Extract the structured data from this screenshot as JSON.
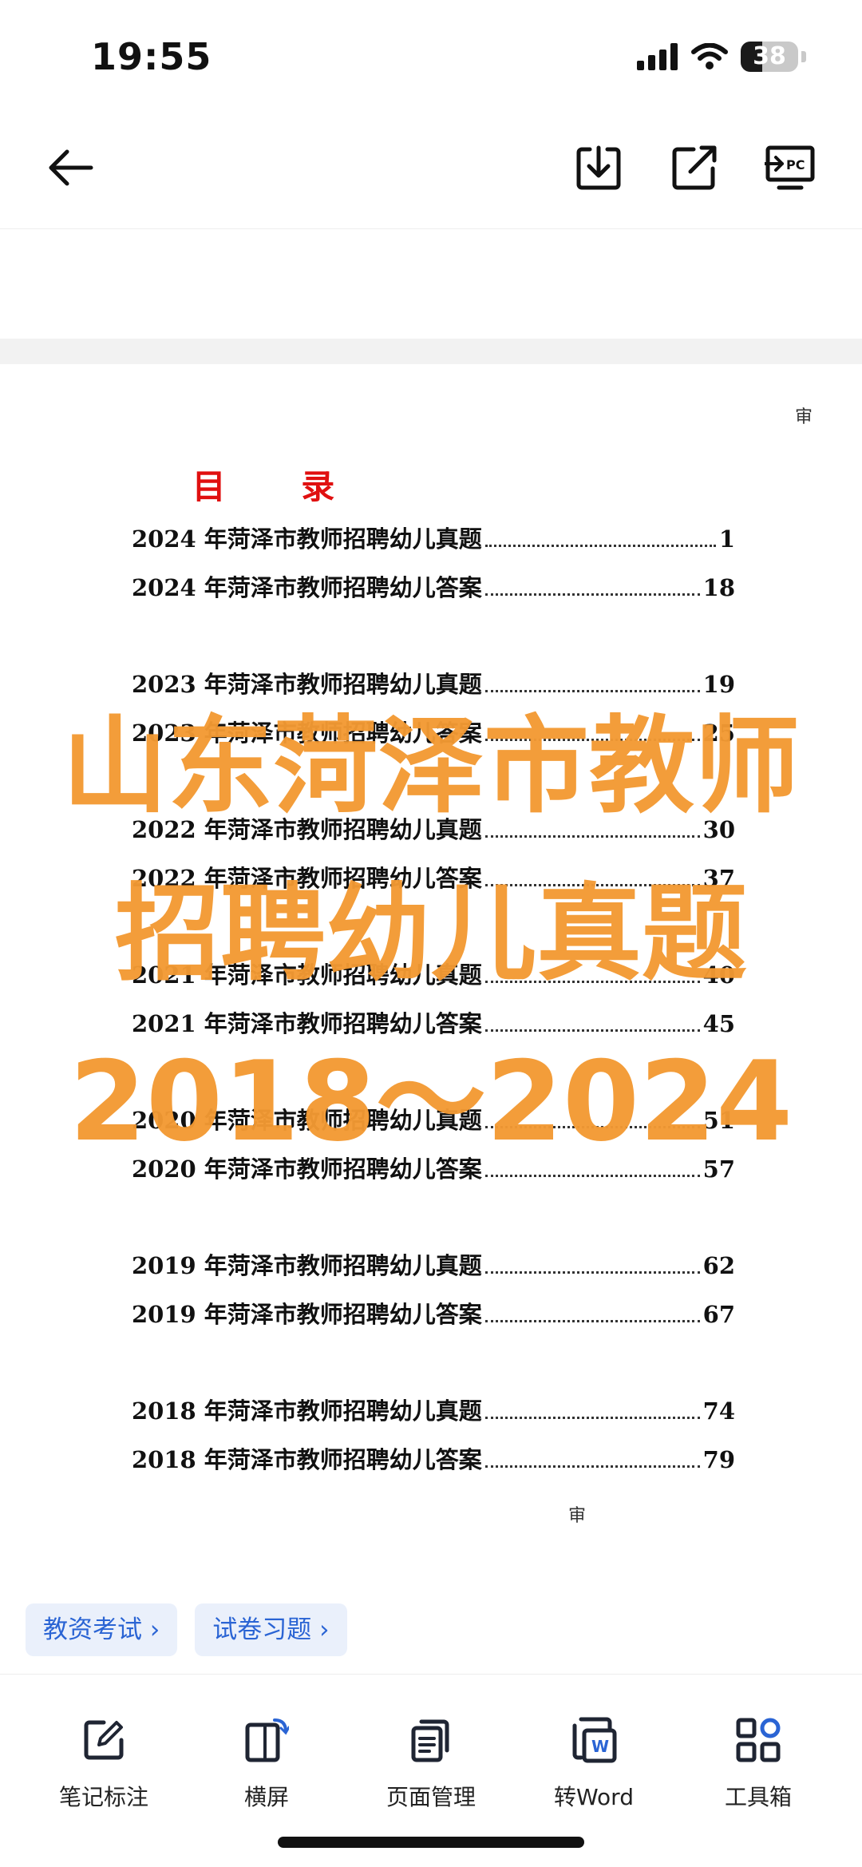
{
  "status_bar": {
    "time": "19:55",
    "battery": "38"
  },
  "toolbar_top": {
    "icons": [
      "back-arrow-icon",
      "download-icon",
      "share-icon",
      "open-on-pc-icon"
    ],
    "pc_label": "PC"
  },
  "document": {
    "corner_mark": "审",
    "bottom_mark": "审",
    "toc_title": "目 录",
    "entries": [
      {
        "label": "2024 年菏泽市教师招聘幼儿真题",
        "page": "1"
      },
      {
        "label": "2024 年菏泽市教师招聘幼儿答案",
        "page": "18"
      },
      {
        "label": "2023 年菏泽市教师招聘幼儿真题",
        "page": "19"
      },
      {
        "label": "2023 年菏泽市教师招聘幼儿答案",
        "page": "25"
      },
      {
        "label": "2022 年菏泽市教师招聘幼儿真题",
        "page": "30"
      },
      {
        "label": "2022 年菏泽市教师招聘幼儿答案",
        "page": "37"
      },
      {
        "label": "2021 年菏泽市教师招聘幼儿真题",
        "page": "40"
      },
      {
        "label": "2021 年菏泽市教师招聘幼儿答案",
        "page": "45"
      },
      {
        "label": "2020 年菏泽市教师招聘幼儿真题",
        "page": "51"
      },
      {
        "label": "2020 年菏泽市教师招聘幼儿答案",
        "page": "57"
      },
      {
        "label": "2019 年菏泽市教师招聘幼儿真题",
        "page": "62"
      },
      {
        "label": "2019 年菏泽市教师招聘幼儿答案",
        "page": "67"
      },
      {
        "label": "2018 年菏泽市教师招聘幼儿真题",
        "page": "74"
      },
      {
        "label": "2018 年菏泽市教师招聘幼儿答案",
        "page": "79"
      }
    ]
  },
  "watermark": {
    "line1": "山东菏泽市教师",
    "line2": "招聘幼儿真题",
    "line3": "2018～2024",
    "color": "#f39a33"
  },
  "chips": [
    {
      "label": "教资考试 ›"
    },
    {
      "label": "试卷习题 ›"
    }
  ],
  "bottom_toolbar": [
    {
      "label": "笔记标注",
      "icon": "edit-note-icon"
    },
    {
      "label": "横屏",
      "icon": "rotate-screen-icon"
    },
    {
      "label": "页面管理",
      "icon": "page-manage-icon"
    },
    {
      "label": "转Word",
      "icon": "word-convert-icon",
      "badge": "W"
    },
    {
      "label": "工具箱",
      "icon": "toolbox-icon"
    }
  ],
  "colors": {
    "accent": "#2a64d4",
    "toc_title": "#e01010",
    "watermark": "#f39a33"
  }
}
